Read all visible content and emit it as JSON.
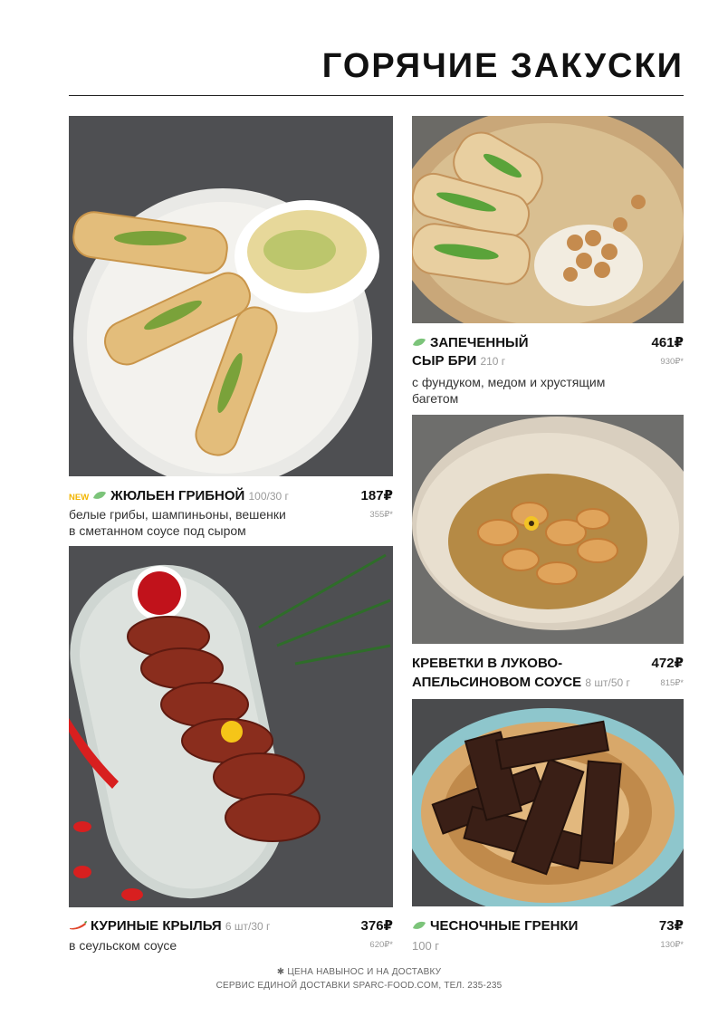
{
  "title": "ГОРЯЧИЕ ЗАКУСКИ",
  "items": {
    "julien": {
      "badge": "NEW",
      "name": "ЖЮЛЬЕН ГРИБНОЙ",
      "weight": "100/30 г",
      "description_line1": "белые грибы, шампиньоны, вешенки",
      "description_line2": "в сметанном соусе под сыром",
      "price": "187₽",
      "delivery_price": "355₽*",
      "icon": "leaf-icon"
    },
    "brie": {
      "name_line1": "ЗАПЕЧЕННЫЙ",
      "name_line2": "СЫР БРИ",
      "weight": "210 г",
      "description_line1": "с фундуком, медом и хрустящим",
      "description_line2": "багетом",
      "price": "461₽",
      "delivery_price": "930₽*",
      "icon": "leaf-icon"
    },
    "shrimp": {
      "name_line1": "КРЕВЕТКИ В ЛУКОВО-",
      "name_line2": "АПЕЛЬСИНОВОМ СОУСЕ",
      "weight": "8 шт/50 г",
      "price": "472₽",
      "delivery_price": "815₽*"
    },
    "wings": {
      "name": "КУРИНЫЕ КРЫЛЬЯ",
      "weight": "6 шт/30 г",
      "description": "в сеульском соусе",
      "price": "376₽",
      "delivery_price": "620₽*",
      "icon": "chili-icon"
    },
    "croutons": {
      "name": "ЧЕСНОЧНЫЕ ГРЕНКИ",
      "weight": "100 г",
      "price": "73₽",
      "delivery_price": "130₽*",
      "icon": "leaf-icon"
    }
  },
  "footer": {
    "line1": "✱ ЦЕНА НАВЫНОС И НА ДОСТАВКУ",
    "line2": "СЕРВИС ЕДИНОЙ ДОСТАВКИ SPARC-FOOD.COM, ТЕЛ. 235-235"
  },
  "colors": {
    "leaf": "#6fbf73",
    "chili": "#e0462b",
    "new": "#f2b500"
  }
}
